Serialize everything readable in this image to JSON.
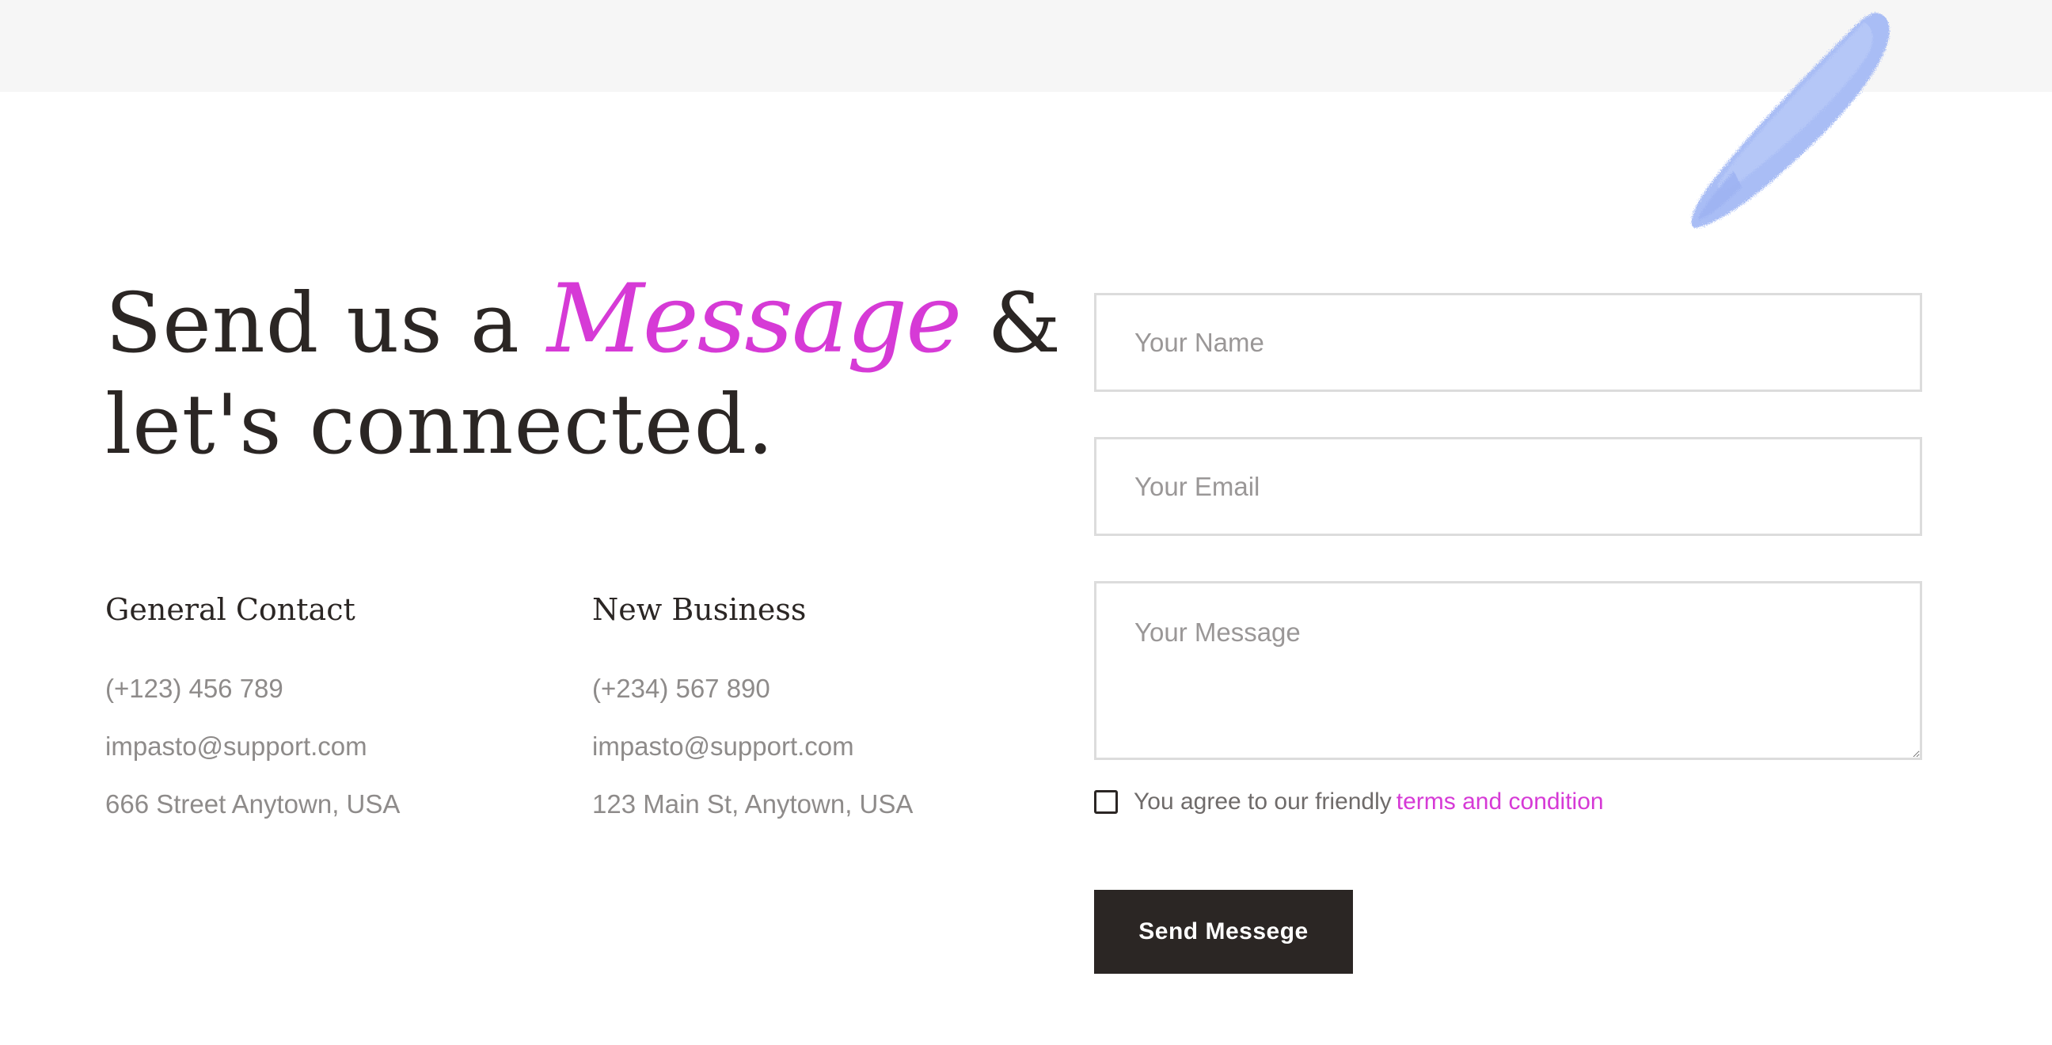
{
  "heading": {
    "line1_prefix": "Send us a",
    "accent": "Message",
    "line1_suffix": "&",
    "line2": "let's connected."
  },
  "general_contact": {
    "title": "General Contact",
    "phone": "(+123) 456 789",
    "email": "impasto@support.com",
    "address": "666 Street Anytown, USA"
  },
  "new_business": {
    "title": "New Business",
    "phone": "(+234) 567 890",
    "email": "impasto@support.com",
    "address": "123 Main St, Anytown, USA"
  },
  "form": {
    "name_placeholder": "Your Name",
    "email_placeholder": "Your Email",
    "message_placeholder": "Your Message",
    "agree_text": "You agree to our friendly",
    "agree_link": "terms and condition",
    "submit_label": "Send Messege"
  },
  "colors": {
    "accent": "#d63ad6",
    "dark": "#2b2624",
    "brush": "#a9bdf5",
    "top_band": "#f6f6f6"
  },
  "icons": {
    "decoration": "paint-brush-stroke"
  }
}
